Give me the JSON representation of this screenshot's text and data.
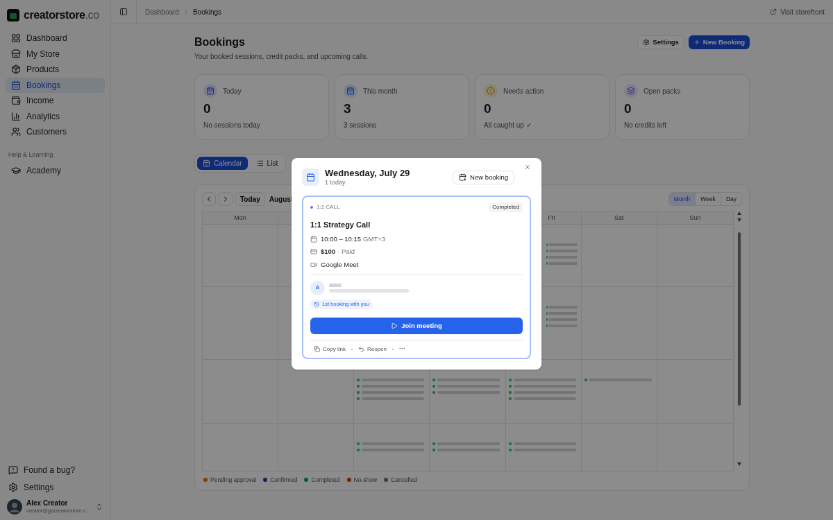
{
  "brand": {
    "name": "creatorstore",
    "suffix": ".co"
  },
  "sidebar": {
    "items": [
      {
        "label": "Dashboard",
        "selected": false
      },
      {
        "label": "My Store",
        "selected": false
      },
      {
        "label": "Products",
        "selected": false
      },
      {
        "label": "Bookings",
        "selected": true
      },
      {
        "label": "Income",
        "selected": false
      },
      {
        "label": "Analytics",
        "selected": false
      },
      {
        "label": "Customers",
        "selected": false
      }
    ],
    "section": "Help & Learning",
    "help_items": [
      {
        "label": "Academy",
        "selected": false
      }
    ],
    "footer_items": [
      {
        "label": "Found a bug?"
      },
      {
        "label": "Settings"
      }
    ],
    "user": {
      "name": "Alex Creator",
      "email": "creator@gocreatorstore.c..."
    }
  },
  "breadcrumb": [
    "Dashboard",
    "Bookings"
  ],
  "visit_storefront": "Visit storefront",
  "page": {
    "title": "Bookings",
    "subtitle": "Your booked sessions, credit packs, and upcoming calls.",
    "settings_button": "Settings",
    "new_button": "New Booking"
  },
  "stats": [
    {
      "label": "Today",
      "value": "0",
      "note": "No sessions today",
      "kind": "today"
    },
    {
      "label": "This month",
      "value": "3",
      "note": "3 sessions",
      "kind": "month"
    },
    {
      "label": "Needs action",
      "value": "0",
      "note": "All caught up ✓",
      "kind": "action"
    },
    {
      "label": "Open packs",
      "value": "0",
      "note": "No credits left",
      "kind": "packs"
    }
  ],
  "view_tabs": [
    {
      "label": "Calendar",
      "kind": "calendar",
      "selected": true
    },
    {
      "label": "List",
      "kind": "list",
      "selected": false
    }
  ],
  "calendar": {
    "today_button": "Today",
    "month_label": "August",
    "ranges": [
      {
        "label": "Month",
        "selected": true
      },
      {
        "label": "Week",
        "selected": false
      },
      {
        "label": "Day",
        "selected": false
      }
    ],
    "weekdays_left": [
      "Mon"
    ],
    "weekdays_right": [
      "Fri",
      "Sat",
      "Sun"
    ],
    "legend": [
      {
        "label": "Pending approval",
        "kind": "pending"
      },
      {
        "label": "Confirmed",
        "kind": "confirmed"
      },
      {
        "label": "Completed",
        "kind": "completed"
      },
      {
        "label": "No-show",
        "kind": "noshow"
      },
      {
        "label": "Cancelled",
        "kind": "cancelled"
      }
    ]
  },
  "dialog": {
    "title": "Wednesday, July 29",
    "subtitle": "1 today",
    "new_button": "New booking",
    "booking": {
      "type": "1:1 CALL",
      "status": "Completed",
      "title": "1:1 Strategy Call",
      "time": "10:00 – 10:15",
      "timezone": "GMT+3",
      "price": "$100",
      "payment": "· Paid",
      "location": "Google Meet",
      "customer_initial": "A",
      "badge": "1st booking with you",
      "join_button": "Join meeting",
      "actions": [
        {
          "label": "Copy link",
          "kind": "copy"
        },
        {
          "label": "Reopen",
          "kind": "undo"
        }
      ],
      "more": "···"
    }
  }
}
